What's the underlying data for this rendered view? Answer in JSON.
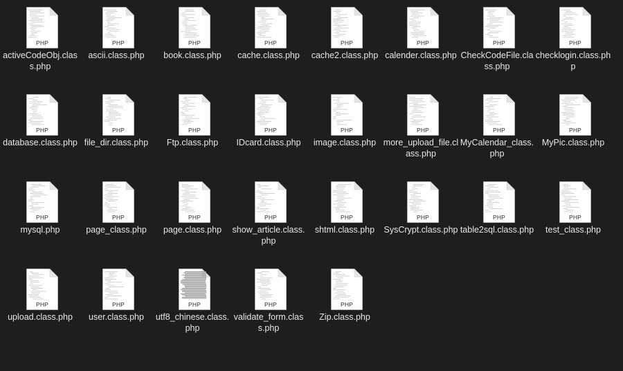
{
  "window": {
    "view": "icon-view"
  },
  "file_type_badge": "PHP",
  "files": [
    {
      "name": "activeCodeObj.class.php"
    },
    {
      "name": "ascii.class.php"
    },
    {
      "name": "book.class.php"
    },
    {
      "name": "cache.class.php"
    },
    {
      "name": "cache2.class.php"
    },
    {
      "name": "calender.class.php"
    },
    {
      "name": "CheckCodeFile.class.php"
    },
    {
      "name": "checklogin.class.php"
    },
    {
      "name": "database.class.php"
    },
    {
      "name": "file_dir.class.php"
    },
    {
      "name": "Ftp.class.php"
    },
    {
      "name": "IDcard.class.php"
    },
    {
      "name": "image.class.php"
    },
    {
      "name": "more_upload_file.class.php"
    },
    {
      "name": "MyCalendar_class.php"
    },
    {
      "name": "MyPic.class.php"
    },
    {
      "name": "mysql.php"
    },
    {
      "name": "page_class.php"
    },
    {
      "name": "page.class.php"
    },
    {
      "name": "show_article.class.php"
    },
    {
      "name": "shtml.class.php"
    },
    {
      "name": "SysCrypt.class.php"
    },
    {
      "name": "table2sql.class.php"
    },
    {
      "name": "test_class.php"
    },
    {
      "name": "upload.class.php"
    },
    {
      "name": "user.class.php"
    },
    {
      "name": "utf8_chinese.class.php"
    },
    {
      "name": "validate_form.class.php"
    },
    {
      "name": "Zip.class.php"
    }
  ]
}
